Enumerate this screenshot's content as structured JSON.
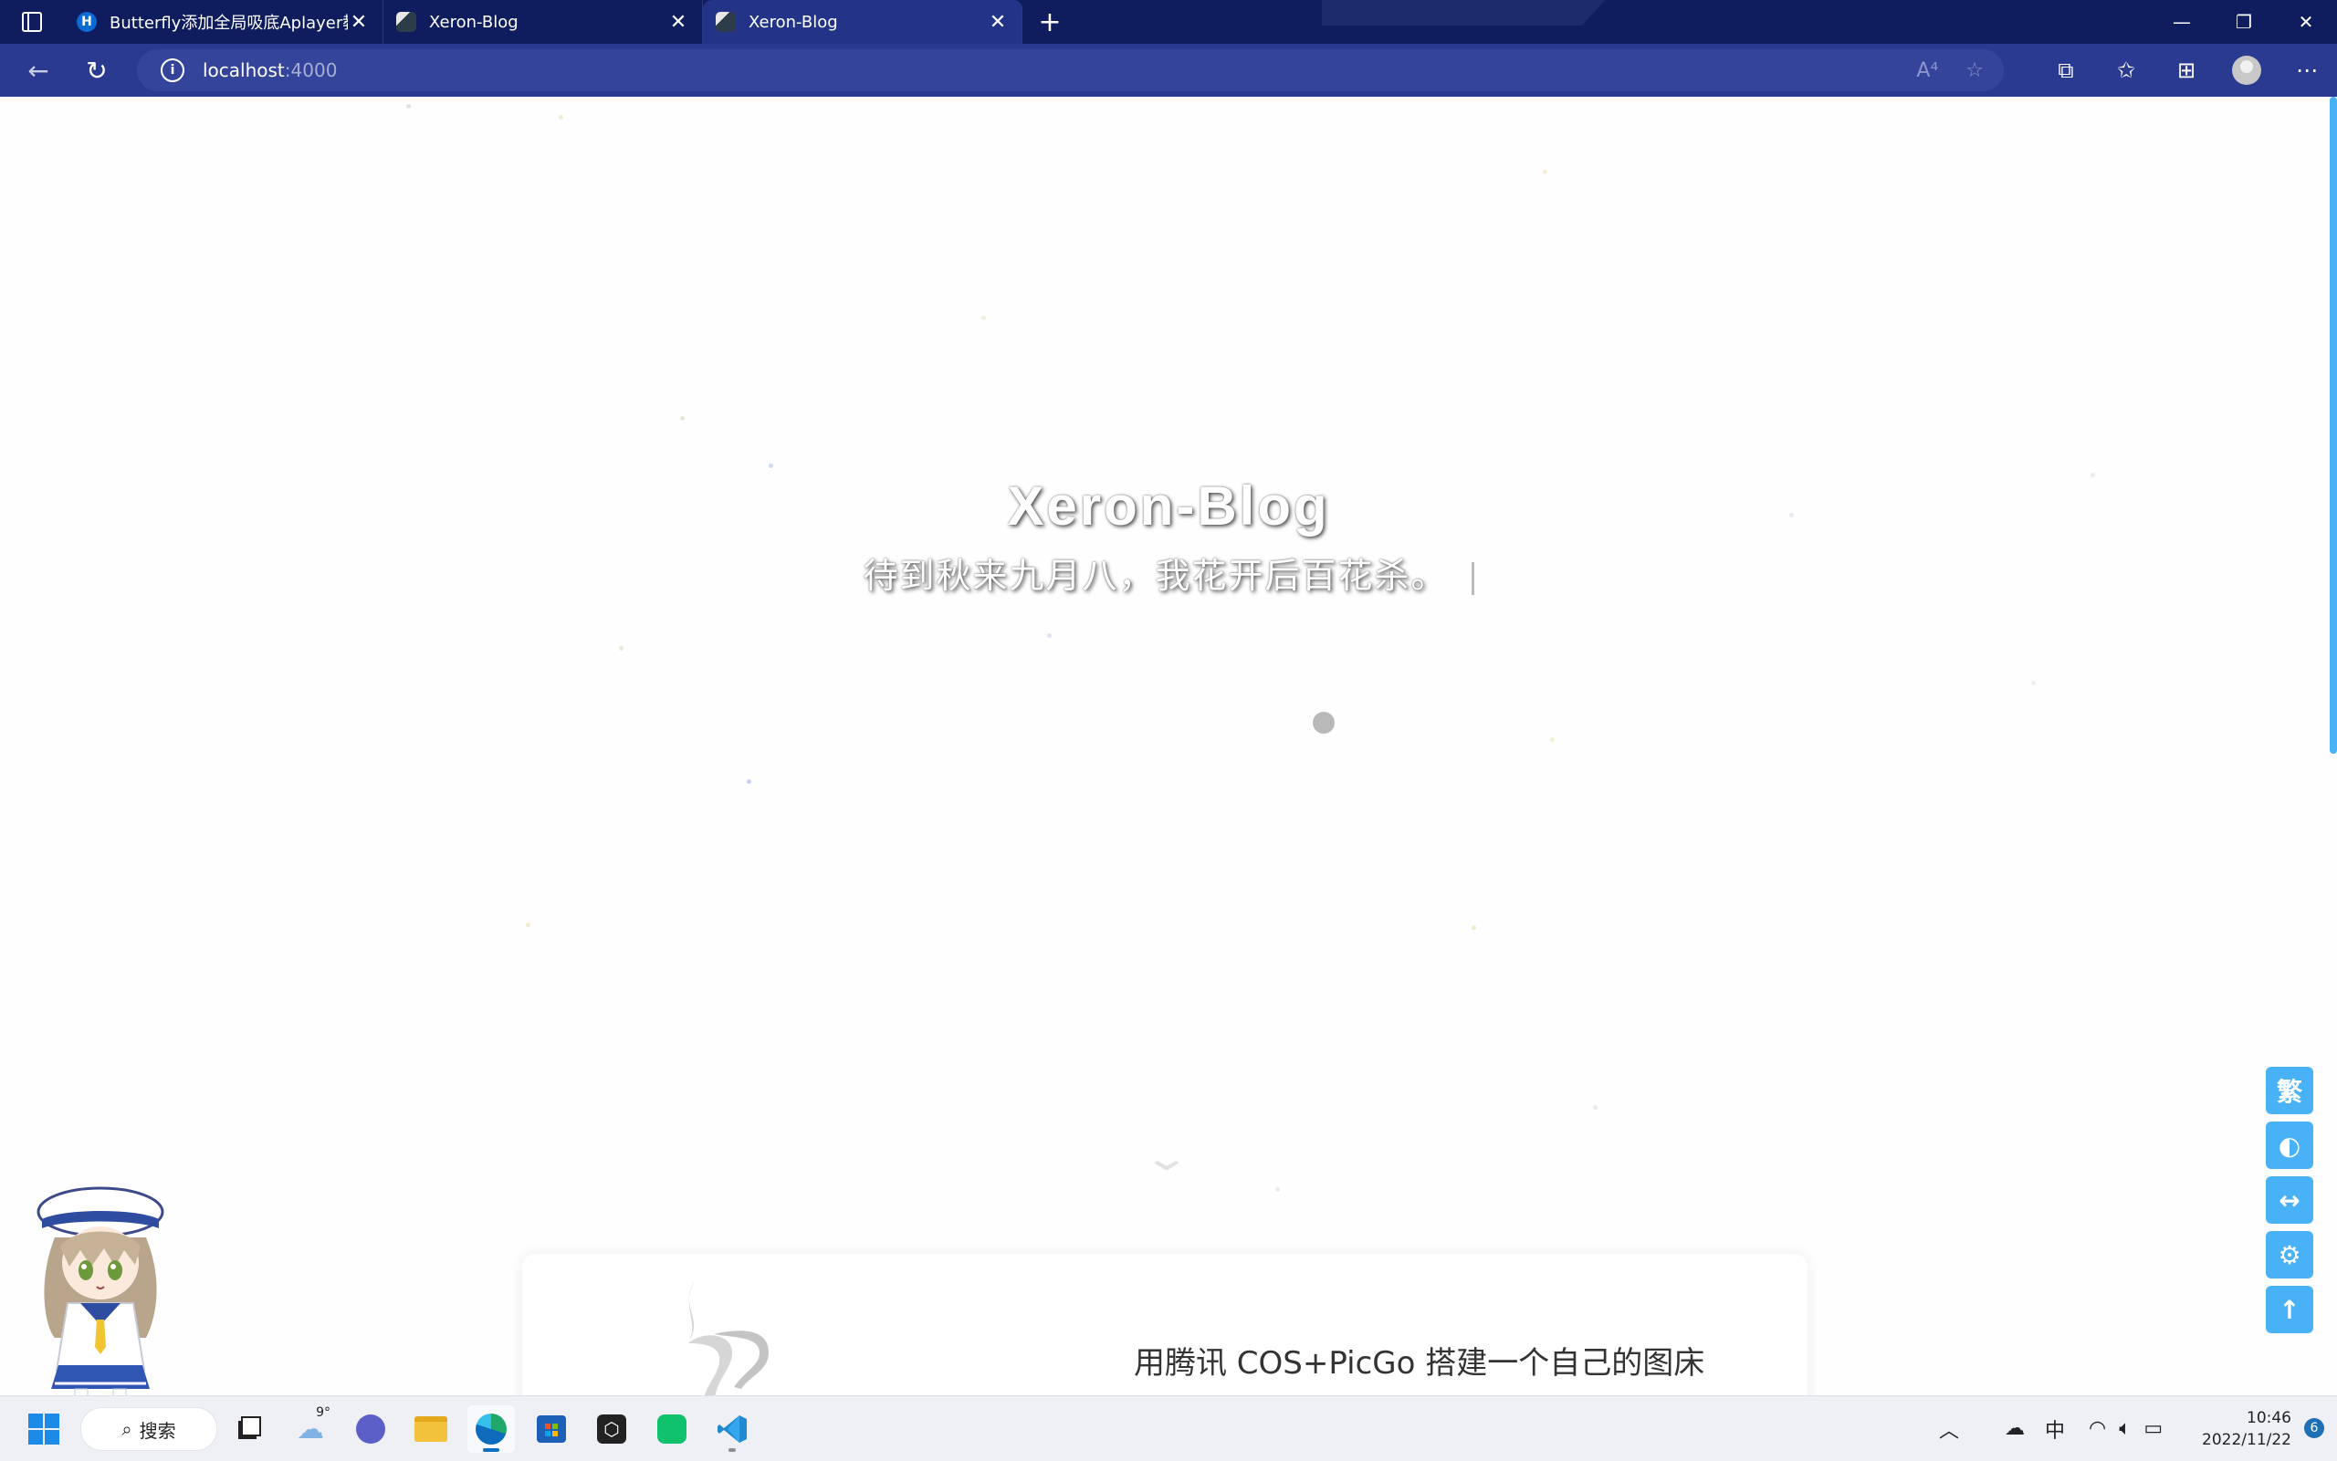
{
  "browser": {
    "tabs": [
      {
        "title": "Butterfly添加全局吸底Aplayer教",
        "favicon": "H"
      },
      {
        "title": "Xeron-Blog"
      },
      {
        "title": "Xeron-Blog"
      }
    ],
    "url_host": "localhost",
    "url_port": ":4000",
    "read_aloud_label": "A⁴"
  },
  "hero": {
    "site_title": "Xeron-Blog",
    "subtitle": "待到秋来九月八，我花开后百花杀。"
  },
  "post_card": {
    "title": "用腾讯 COS+PicGo 搭建一个自己的图床"
  },
  "rightside": {
    "translate_label": "繁"
  },
  "taskbar": {
    "search_label": "搜索",
    "weather_temp": "9°",
    "ime_label": "中",
    "time": "10:46",
    "date": "2022/11/22",
    "notification_count": "6"
  },
  "colors": {
    "tabbar_bg": "#0f1d5e",
    "addressbar_bg": "#2a3a91",
    "accent": "#49b1f5"
  }
}
